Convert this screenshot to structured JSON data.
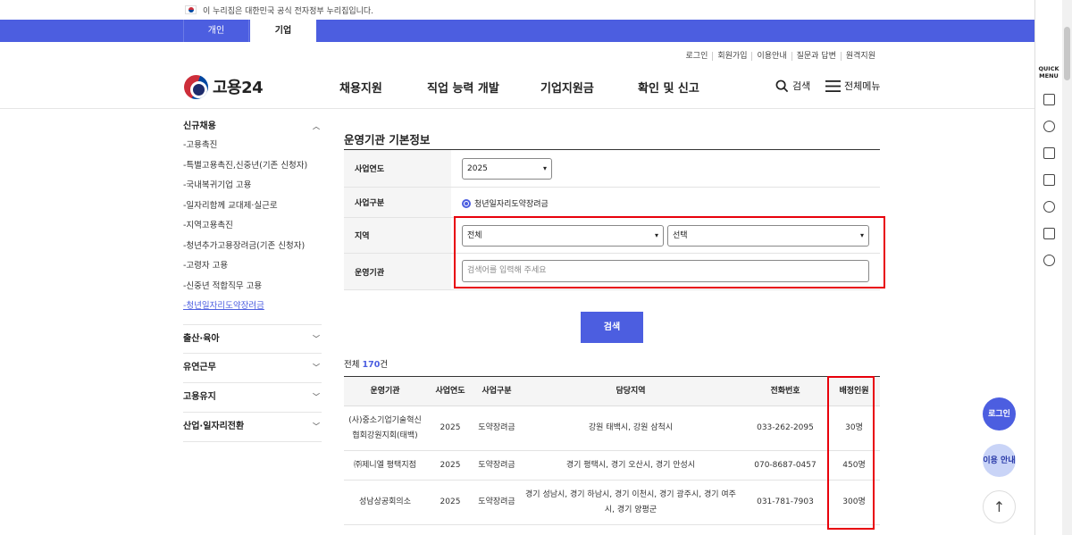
{
  "gov_banner": {
    "text": "이 누리집은 대한민국 공식 전자정부 누리집입니다."
  },
  "tabs": [
    {
      "label": "개인"
    },
    {
      "label": "기업"
    }
  ],
  "util_links": [
    "로그인",
    "회원가입",
    "이용안내",
    "질문과 답변",
    "원격지원"
  ],
  "header": {
    "logo_text": "고용24",
    "nav": [
      "채용지원",
      "직업 능력 개발",
      "기업지원금",
      "확인 및 신고"
    ],
    "search_label": "검색",
    "menu_label": "전체메뉴"
  },
  "sidebar": {
    "section_title": "신규채용",
    "items": [
      "-고용촉진",
      "-특별고용촉진,신중년(기존 신청자)",
      "-국내복귀기업 고용",
      "-일자리함께 교대제·실근로",
      "-지역고용촉진",
      "-청년추가고용장려금(기존 신청자)",
      "-고령자 고용",
      "-신중년 적합직무 고용",
      "-청년일자리도약장려금"
    ],
    "groups": [
      "출산·육아",
      "유연근무",
      "고용유지",
      "산업·일자리전환"
    ]
  },
  "main": {
    "title": "운영기관 기본정보",
    "form": {
      "year_label": "사업연도",
      "year_value": "2025",
      "type_label": "사업구분",
      "type_value": "청년일자리도약장려금",
      "region_label": "지역",
      "region_value": "전체",
      "region_sub_value": "선택",
      "org_label": "운영기관",
      "org_placeholder": "검색어를 입력해 주세요"
    },
    "search_button": "검색",
    "total_prefix": "전체 ",
    "total_count": "170",
    "total_suffix": "건"
  },
  "table": {
    "headers": [
      "운영기관",
      "사업연도",
      "사업구분",
      "담당지역",
      "전화번호",
      "배정인원"
    ],
    "rows": [
      {
        "org": "(사)중소기업기술혁신협회강원지회(태백)",
        "year": "2025",
        "type": "도약장려금",
        "region": "강원 태백시, 강원 삼척시",
        "phone": "033-262-2095",
        "quota": "30명"
      },
      {
        "org": "㈜제니엘 평택지점",
        "year": "2025",
        "type": "도약장려금",
        "region": "경기 평택시, 경기 오산시, 경기 안성시",
        "phone": "070-8687-0457",
        "quota": "450명"
      },
      {
        "org": "성남상공회의소",
        "year": "2025",
        "type": "도약장려금",
        "region": "경기 성남시, 경기 하남시, 경기 이천시, 경기 광주시, 경기 여주시, 경기 양평군",
        "phone": "031-781-7903",
        "quota": "300명"
      }
    ]
  },
  "quick_menu": {
    "label": "QUICK MENU"
  },
  "float_buttons": {
    "login": "로그인",
    "guide": "이용 안내",
    "top": "↑"
  }
}
